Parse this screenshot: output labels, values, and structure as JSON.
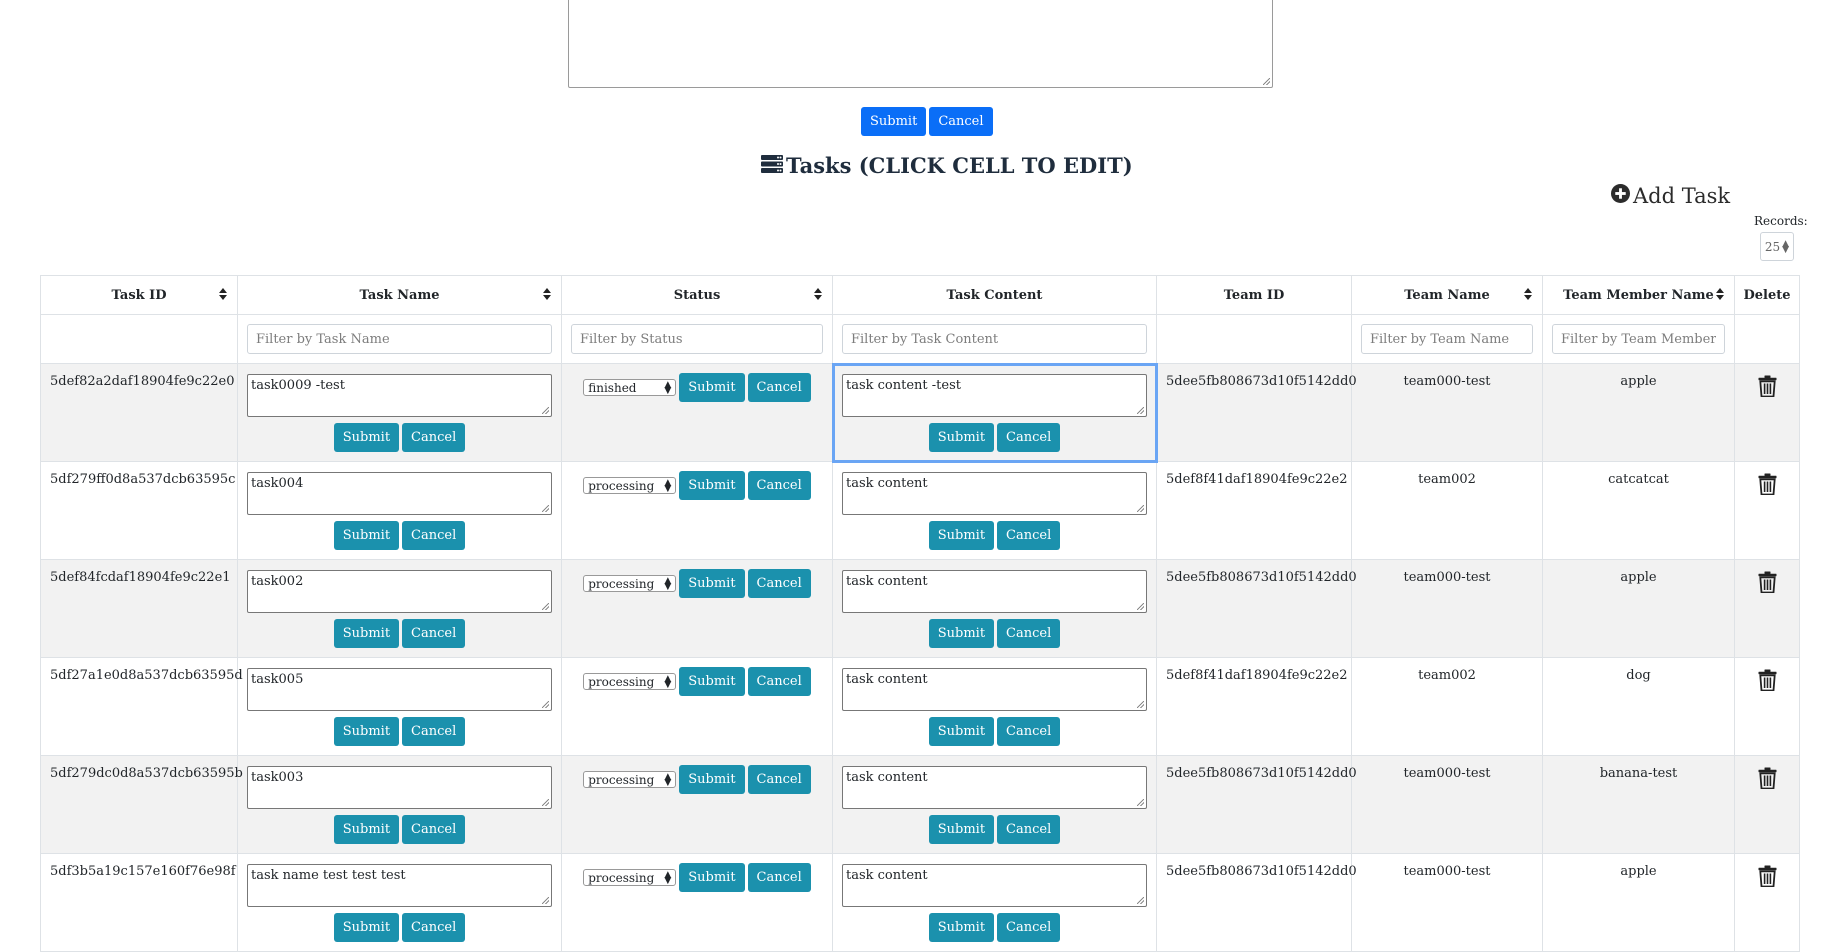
{
  "top_form": {
    "submit_label": "Submit",
    "cancel_label": "Cancel"
  },
  "page": {
    "title": "Tasks (CLICK CELL TO EDIT)",
    "add_task_label": "Add Task"
  },
  "records": {
    "label": "Records:",
    "value": "25"
  },
  "table": {
    "headers": {
      "task_id": "Task ID",
      "task_name": "Task Name",
      "status": "Status",
      "task_content": "Task Content",
      "team_id": "Team ID",
      "team_name": "Team Name",
      "member_name": "Team Member Name",
      "delete": "Delete"
    },
    "filters": {
      "task_name": "Filter by Task Name",
      "status": "Filter by Status",
      "task_content": "Filter by Task Content",
      "team_name": "Filter by Team Name",
      "member_name": "Filter by Team Member Name"
    },
    "submit_label": "Submit",
    "cancel_label": "Cancel",
    "rows": [
      {
        "task_id": "5def82a2daf18904fe9c22e0",
        "task_name": "task0009 -test",
        "status": "finished",
        "task_content": "task content -test",
        "team_id": "5dee5fb808673d10f5142dd0",
        "team_name": "team000-test",
        "member_name": "apple"
      },
      {
        "task_id": "5df279ff0d8a537dcb63595c",
        "task_name": "task004",
        "status": "processing",
        "task_content": "task content",
        "team_id": "5def8f41daf18904fe9c22e2",
        "team_name": "team002",
        "member_name": "catcatcat"
      },
      {
        "task_id": "5def84fcdaf18904fe9c22e1",
        "task_name": "task002",
        "status": "processing",
        "task_content": "task content",
        "team_id": "5dee5fb808673d10f5142dd0",
        "team_name": "team000-test",
        "member_name": "apple"
      },
      {
        "task_id": "5df27a1e0d8a537dcb63595d",
        "task_name": "task005",
        "status": "processing",
        "task_content": "task content",
        "team_id": "5def8f41daf18904fe9c22e2",
        "team_name": "team002",
        "member_name": "dog"
      },
      {
        "task_id": "5df279dc0d8a537dcb63595b",
        "task_name": "task003",
        "status": "processing",
        "task_content": "task content",
        "team_id": "5dee5fb808673d10f5142dd0",
        "team_name": "team000-test",
        "member_name": "banana-test"
      },
      {
        "task_id": "5df3b5a19c157e160f76e98f",
        "task_name": "task name test test test",
        "status": "processing",
        "task_content": "task content",
        "team_id": "5dee5fb808673d10f5142dd0",
        "team_name": "team000-test",
        "member_name": "apple"
      }
    ]
  },
  "colors": {
    "primary": "#0a6ef7",
    "info": "#1b91ad",
    "stripe": "#f2f2f2",
    "selected_outline": "#6aa5f4",
    "title_text": "#1f2d3d"
  },
  "icons": {
    "title": "server-icon",
    "add": "plus-circle-icon",
    "delete": "trash-icon"
  }
}
